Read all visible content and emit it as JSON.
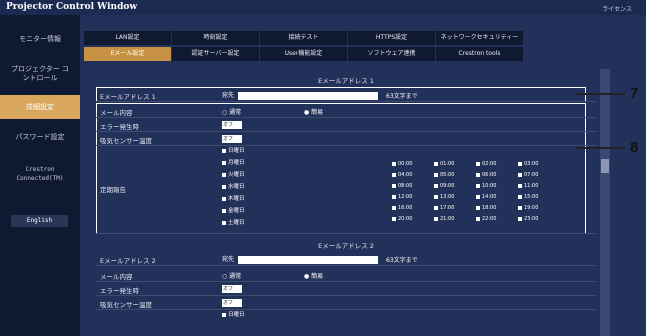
{
  "window": {
    "title": "Projector Control Window",
    "license": "ライセンス"
  },
  "sidebar": {
    "items": [
      {
        "label": "モニター情報"
      },
      {
        "label": "プロジェクター コントロール"
      },
      {
        "label": "詳細設定"
      },
      {
        "label": "パスワード設定"
      },
      {
        "label": "Crestron Connected(TM)"
      },
      {
        "label": "English"
      }
    ]
  },
  "tabs": {
    "row1": [
      "LAN設定",
      "時刻設定",
      "接続テスト",
      "HTTPS設定",
      "ネットワークセキュリティー"
    ],
    "row2": [
      "Eメール設定",
      "認証サーバー設定",
      "User機能設定",
      "ソフトウェア連携",
      "Crestron tools"
    ]
  },
  "email1": {
    "section_title": "Eメールアドレス 1",
    "address_label": "Eメールアドレス 1",
    "address_prefix": "宛先",
    "address_hint": "63文字まで",
    "content_label": "メール内容",
    "content_opt1": "通常",
    "content_opt2": "簡易",
    "error_label": "エラー発生時",
    "error_value": "オフ",
    "sensor_label": "吸気センサー温度",
    "sensor_value": "オフ",
    "report_label": "定期報告",
    "days": [
      "日曜日",
      "月曜日",
      "火曜日",
      "水曜日",
      "木曜日",
      "金曜日",
      "土曜日"
    ],
    "hours": [
      "00:00",
      "04:00",
      "08:00",
      "12:00",
      "16:00",
      "20:00",
      "01:00",
      "05:00",
      "09:00",
      "13:00",
      "17:00",
      "21:00",
      "02:00",
      "06:00",
      "10:00",
      "14:00",
      "18:00",
      "22:00",
      "03:00",
      "07:00",
      "11:00",
      "15:00",
      "19:00",
      "23:00"
    ]
  },
  "email2": {
    "section_title": "Eメールアドレス 2",
    "address_label": "Eメールアドレス 2",
    "address_prefix": "宛先",
    "address_hint": "63文字まで",
    "content_label": "メール内容",
    "content_opt1": "通常",
    "content_opt2": "簡易",
    "error_label": "エラー発生時",
    "error_value": "オフ",
    "sensor_label": "吸気センサー温度",
    "sensor_value": "オフ",
    "first_day": "日曜日"
  },
  "callouts": {
    "c7": "7",
    "c8": "8"
  },
  "colors": {
    "accent": "#d8a65c",
    "titlebar": "#1b2a50",
    "sidebar": "#0f1931",
    "main": "#22315a"
  }
}
